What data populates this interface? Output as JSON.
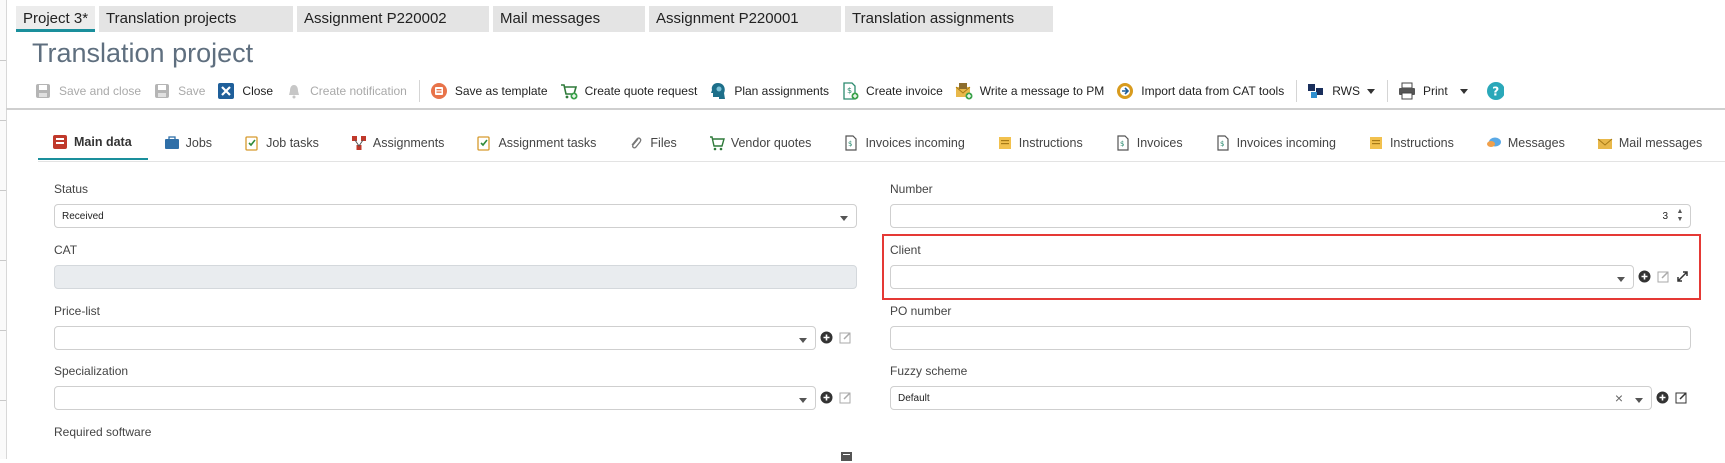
{
  "doc_tabs": [
    {
      "label": "Project 3*"
    },
    {
      "label": "Translation projects"
    },
    {
      "label": "Assignment P220002"
    },
    {
      "label": "Mail messages"
    },
    {
      "label": "Assignment P220001"
    },
    {
      "label": "Translation assignments"
    }
  ],
  "page_title": "Translation project",
  "toolbar": {
    "save_and_close": "Save and close",
    "save": "Save",
    "close": "Close",
    "create_notification": "Create notification",
    "save_as_template": "Save as template",
    "create_quote_request": "Create quote request",
    "plan_assignments": "Plan assignments",
    "create_invoice": "Create invoice",
    "write_message_pm": "Write a message to PM",
    "import_cat": "Import data from CAT tools",
    "rws": "RWS",
    "print": "Print"
  },
  "section_tabs": [
    {
      "label": "Main data",
      "icon": "main-data-icon"
    },
    {
      "label": "Jobs",
      "icon": "briefcase-icon"
    },
    {
      "label": "Job tasks",
      "icon": "clipboard-check-icon"
    },
    {
      "label": "Assignments",
      "icon": "assignments-icon"
    },
    {
      "label": "Assignment tasks",
      "icon": "clipboard-check-icon"
    },
    {
      "label": "Files",
      "icon": "paperclip-icon"
    },
    {
      "label": "Vendor quotes",
      "icon": "cart-icon"
    },
    {
      "label": "Invoices incoming",
      "icon": "invoice-icon"
    },
    {
      "label": "Instructions",
      "icon": "note-icon"
    },
    {
      "label": "Invoices",
      "icon": "invoice-icon"
    },
    {
      "label": "Invoices incoming",
      "icon": "invoice-icon"
    },
    {
      "label": "Instructions",
      "icon": "note-icon"
    },
    {
      "label": "Messages",
      "icon": "chat-icon"
    },
    {
      "label": "Mail messages",
      "icon": "envelope-icon"
    }
  ],
  "form": {
    "status": {
      "label": "Status",
      "value": "Received"
    },
    "number": {
      "label": "Number",
      "value": "3"
    },
    "cat": {
      "label": "CAT",
      "value": ""
    },
    "client": {
      "label": "Client",
      "value": ""
    },
    "price_list": {
      "label": "Price-list",
      "value": ""
    },
    "po_number": {
      "label": "PO number",
      "value": ""
    },
    "specialization": {
      "label": "Specialization",
      "value": ""
    },
    "fuzzy_scheme": {
      "label": "Fuzzy scheme",
      "value": "Default"
    },
    "required_software": {
      "label": "Required software"
    }
  },
  "colors": {
    "accent": "#1a8f9c",
    "highlight": "#e53935"
  }
}
